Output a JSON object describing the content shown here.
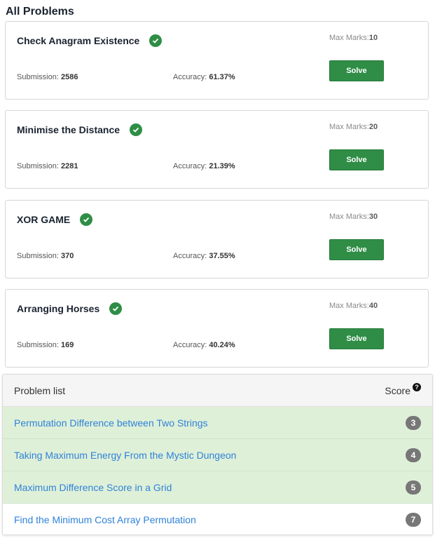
{
  "page": {
    "title": "All Problems"
  },
  "labels": {
    "max_marks": "Max Marks:",
    "submission": "Submission:",
    "accuracy": "Accuracy:",
    "solve": "Solve"
  },
  "problems": [
    {
      "title": "Check Anagram Existence",
      "max_marks": "10",
      "submissions": "2586",
      "accuracy": "61.37%"
    },
    {
      "title": "Minimise the Distance",
      "max_marks": "20",
      "submissions": "2281",
      "accuracy": "21.39%"
    },
    {
      "title": "XOR GAME",
      "max_marks": "30",
      "submissions": "370",
      "accuracy": "37.55%"
    },
    {
      "title": "Arranging Horses",
      "max_marks": "40",
      "submissions": "169",
      "accuracy": "40.24%"
    }
  ],
  "problem_list": {
    "header": "Problem list",
    "score_label": "Score",
    "help_icon": "?",
    "items": [
      {
        "title": "Permutation Difference between Two Strings",
        "score": "3",
        "status": "solved"
      },
      {
        "title": "Taking Maximum Energy From the Mystic Dungeon",
        "score": "4",
        "status": "solved"
      },
      {
        "title": "Maximum Difference Score in a Grid",
        "score": "5",
        "status": "solved"
      },
      {
        "title": "Find the Minimum Cost Array Permutation",
        "score": "7",
        "status": "unsolved"
      }
    ]
  },
  "colors": {
    "accent_green": "#2f8d46",
    "solved_row": "#dff0d8",
    "link_blue": "#2f82d9",
    "badge_gray": "#777777"
  },
  "icons": {
    "solved": "check-circle-icon",
    "help": "question-circle-icon"
  }
}
